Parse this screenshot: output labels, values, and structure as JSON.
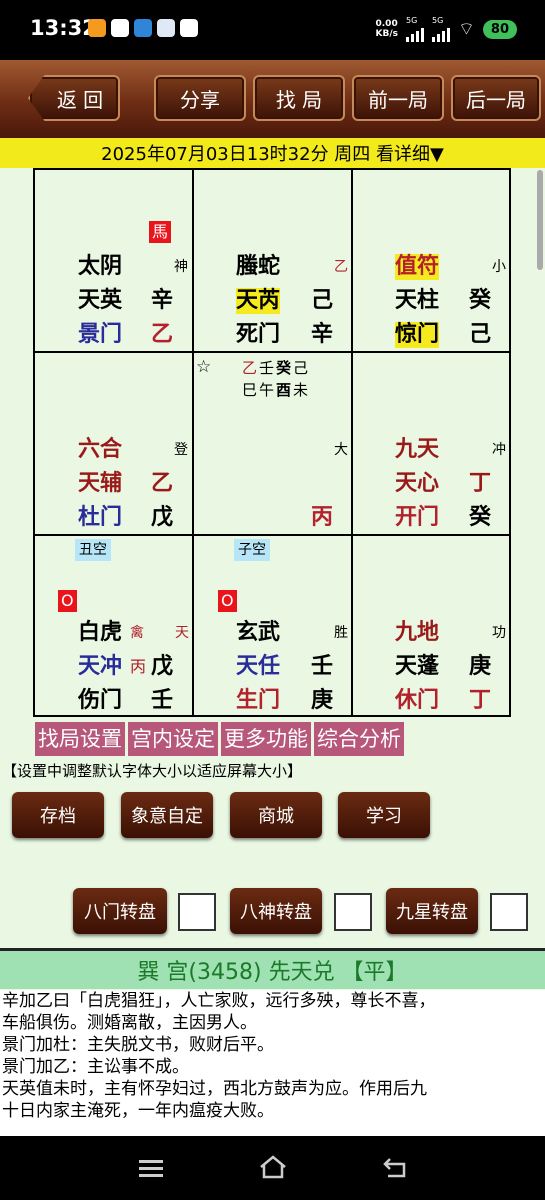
{
  "status": {
    "time": "13:32",
    "net_speed": "0.00\nKB/s",
    "sig1": "5G",
    "sig2": "5G",
    "battery": "80"
  },
  "toolbar": {
    "back": "返 回",
    "share": "分享",
    "find": "找 局",
    "prev": "前一局",
    "next": "后一局"
  },
  "date_text": "2025年07月03日13时32分 周四 看详细▼",
  "grid": {
    "c1": {
      "tag": "馬",
      "god": "太阴",
      "god_note": "神",
      "star": "天英",
      "star_stem": "辛",
      "door": "景门",
      "door_stem": "乙"
    },
    "c2": {
      "god": "螣蛇",
      "god_note": "乙",
      "star": "天芮",
      "star_stem": "己",
      "door": "死门",
      "door_stem": "辛"
    },
    "c3": {
      "god": "值符",
      "god_note": "小",
      "star": "天柱",
      "star_stem": "癸",
      "door": "惊门",
      "door_stem": "己"
    },
    "c4": {
      "god": "六合",
      "god_note": "登",
      "star": "天辅",
      "star_stem": "乙",
      "door": "杜门",
      "door_stem": "戊"
    },
    "c5": {
      "star_mark": "☆",
      "row1": [
        "乙",
        "壬",
        "癸",
        "己"
      ],
      "row2": [
        "巳",
        "午",
        "酉",
        "未"
      ],
      "note": "大",
      "stem": "丙"
    },
    "c6": {
      "god": "九天",
      "god_note": "冲",
      "star": "天心",
      "star_stem": "丁",
      "door": "开门",
      "door_stem": "癸"
    },
    "c7": {
      "kong": "丑空",
      "tag": "O",
      "god": "白虎",
      "god_note1": "禽",
      "god_note2": "天",
      "star": "天冲",
      "star_extra": "丙",
      "star_stem": "戊",
      "door": "伤门",
      "door_stem": "壬"
    },
    "c8": {
      "kong": "子空",
      "tag": "O",
      "god": "玄武",
      "god_note": "胜",
      "star": "天任",
      "star_stem": "壬",
      "door": "生门",
      "door_stem": "庚"
    },
    "c9": {
      "god": "九地",
      "god_note": "功",
      "star": "天蓬",
      "star_stem": "庚",
      "door": "休门",
      "door_stem": "丁"
    }
  },
  "funcbar": [
    "找局设置",
    "宫内设定",
    "更多功能",
    "综合分析"
  ],
  "note": "【设置中调整默认字体大小以适应屏幕大小】",
  "buttons": {
    "save": "存档",
    "custom": "象意自定",
    "shop": "商城",
    "learn": "学习"
  },
  "rotate": {
    "door": "八门转盘",
    "god": "八神转盘",
    "star": "九星转盘"
  },
  "palace_title": "巽 宫(3458) 先天兑  【平】",
  "desc": [
    "辛加乙曰「白虎猖狂」，人亡家败，远行多殃，尊长不喜，",
    "车船俱伤。测婚离散，主因男人。",
    "景门加杜：主失脱文书，败财后平。",
    "景门加乙：主讼事不成。",
    "天英值未时，主有怀孕妇过，西北方鼓声为应。作用后九",
    "十日内家主淹死，一年内瘟疫大败。"
  ],
  "colors": {
    "toolbar": "#6e2d14",
    "date_bar": "#f2ea1a",
    "func": "#b7587a",
    "palace": "#9fe1b2"
  }
}
